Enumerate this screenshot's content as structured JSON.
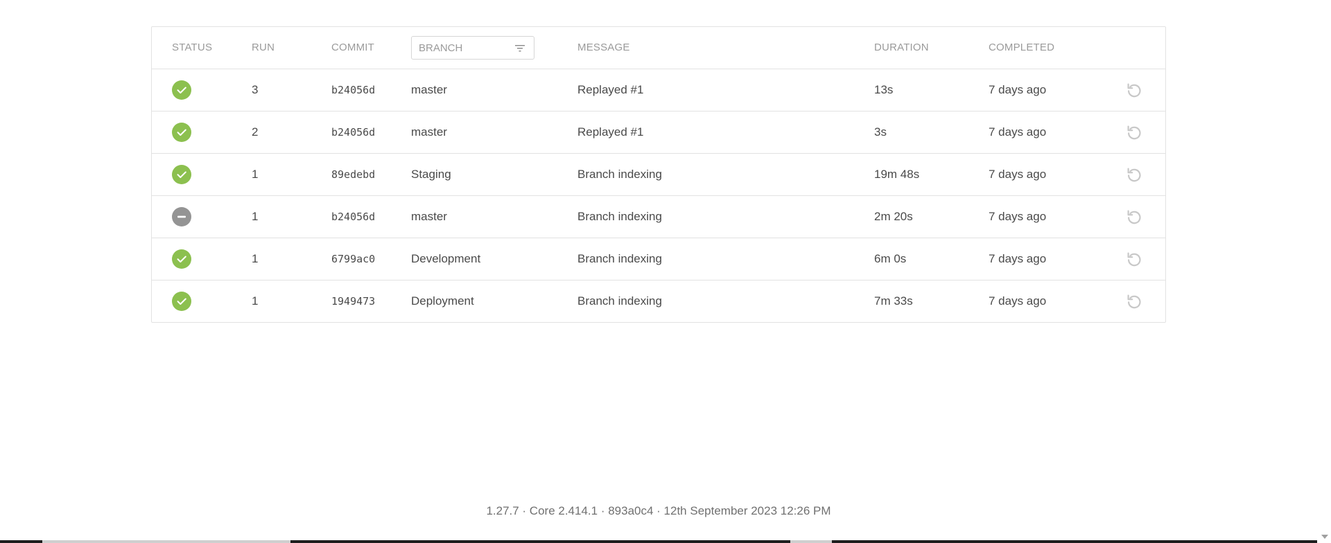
{
  "columns": {
    "status": "STATUS",
    "run": "RUN",
    "commit": "COMMIT",
    "branch_placeholder": "BRANCH",
    "message": "MESSAGE",
    "duration": "DURATION",
    "completed": "COMPLETED"
  },
  "colors": {
    "success": "#8cc04f",
    "aborted": "#949494",
    "replay": "#c8c8c8"
  },
  "rows": [
    {
      "status": "success",
      "status_icon": "check-circle-icon",
      "run": "3",
      "commit": "b24056d",
      "branch": "master",
      "message": "Replayed #1",
      "duration": "13s",
      "completed": "7 days ago"
    },
    {
      "status": "success",
      "status_icon": "check-circle-icon",
      "run": "2",
      "commit": "b24056d",
      "branch": "master",
      "message": "Replayed #1",
      "duration": "3s",
      "completed": "7 days ago"
    },
    {
      "status": "success",
      "status_icon": "check-circle-icon",
      "run": "1",
      "commit": "89edebd",
      "branch": "Staging",
      "message": "Branch indexing",
      "duration": "19m 48s",
      "completed": "7 days ago"
    },
    {
      "status": "aborted",
      "status_icon": "minus-circle-icon",
      "run": "1",
      "commit": "b24056d",
      "branch": "master",
      "message": "Branch indexing",
      "duration": "2m 20s",
      "completed": "7 days ago"
    },
    {
      "status": "success",
      "status_icon": "check-circle-icon",
      "run": "1",
      "commit": "6799ac0",
      "branch": "Development",
      "message": "Branch indexing",
      "duration": "6m 0s",
      "completed": "7 days ago"
    },
    {
      "status": "success",
      "status_icon": "check-circle-icon",
      "run": "1",
      "commit": "1949473",
      "branch": "Deployment",
      "message": "Branch indexing",
      "duration": "7m 33s",
      "completed": "7 days ago"
    }
  ],
  "footer": "1.27.7 · Core 2.414.1 · 893a0c4 · 12th September 2023 12:26 PM"
}
